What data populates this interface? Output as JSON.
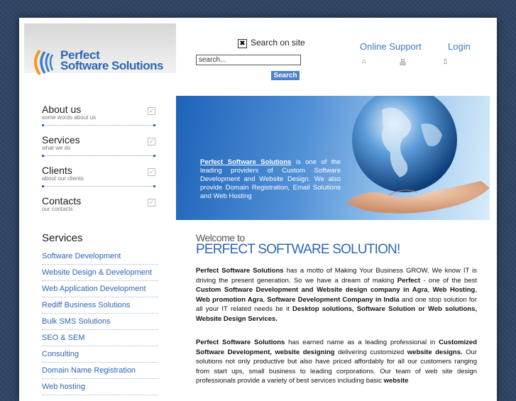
{
  "header": {
    "logo_line1": "Perfect",
    "logo_line2": "Software Solutions",
    "search_on_site_label": "Search on site",
    "search_placeholder": "search...",
    "search_button": "Search",
    "online_support": "Online Support",
    "login": "Login"
  },
  "nav": [
    {
      "title": "About us",
      "subtitle": "some words about us"
    },
    {
      "title": "Services",
      "subtitle": "what we do"
    },
    {
      "title": "Clients",
      "subtitle": "about our clients"
    },
    {
      "title": "Contacts",
      "subtitle": "our contacts"
    }
  ],
  "banner": {
    "company_link": "Perfect Software Solutions",
    "text": " is one of the leading providers of Custom Software Development and Website Design. We also provide Domain Registration, Email Solutions and Web Hosting"
  },
  "services": {
    "title": "Services",
    "items": [
      "Software Development",
      "Website Design & Development",
      "Web Application Development",
      "Rediff Business Solutions",
      "Bulk SMS Solutions",
      "SEO & SEM",
      "Consulting",
      "Domain Name Registration",
      "Web hosting"
    ]
  },
  "main": {
    "welcome_line1": "Welcome to",
    "welcome_line2": "PERFECT SOFTWARE SOLUTION!",
    "p1": [
      {
        "b": true,
        "t": "Perfect Software Solutions"
      },
      {
        "b": false,
        "t": " has a motto of Making Your Business GROW. We know IT is driving the present generation. So we have a dream of making "
      },
      {
        "b": true,
        "t": "Perfect"
      },
      {
        "b": false,
        "t": " - one of the best "
      },
      {
        "b": true,
        "t": "Custom Software Development and Website design company in Agra"
      },
      {
        "b": false,
        "t": ", "
      },
      {
        "b": true,
        "t": "Web Hosting"
      },
      {
        "b": false,
        "t": ", "
      },
      {
        "b": true,
        "t": "Web promotion Agra"
      },
      {
        "b": false,
        "t": ", "
      },
      {
        "b": true,
        "t": "Software Development Company in India"
      },
      {
        "b": false,
        "t": " and one stop solution for all your IT related needs be it "
      },
      {
        "b": true,
        "t": "Desktop solutions, Software Solution or Web solutions, Website Design Services."
      }
    ],
    "p2": [
      {
        "b": true,
        "t": "Perfect Software Solutions"
      },
      {
        "b": false,
        "t": " has earned name as a leading professional in "
      },
      {
        "b": true,
        "t": "Customized Software Development, website designing"
      },
      {
        "b": false,
        "t": " delivering customized "
      },
      {
        "b": true,
        "t": "website designs."
      },
      {
        "b": false,
        "t": " Our solutions not only productive but also have priced affordably for all our customers ranging from start ups, small business to leading corporations. Our team of web site design professionals provide a variety of best services including basic "
      },
      {
        "b": true,
        "t": "website"
      }
    ]
  },
  "colors": {
    "accent": "#2d66b4",
    "background": "#2f4565",
    "search_button": "#4f80c8"
  },
  "icons": [
    "checkbox-x-icon",
    "home-icon",
    "sitemap-icon",
    "contact-icon",
    "check-icon",
    "globe-in-hand-icon"
  ]
}
